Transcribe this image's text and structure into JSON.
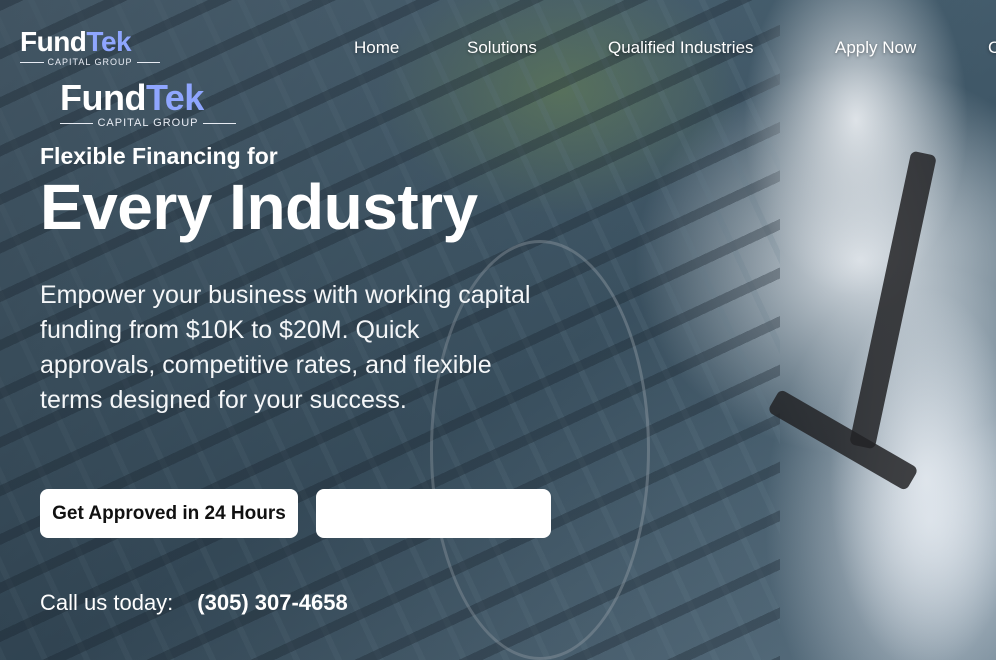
{
  "brand": {
    "name_part1": "Fund",
    "name_part2": "Tek",
    "tagline": "CAPITAL GROUP"
  },
  "nav": {
    "items": [
      {
        "label": "Home"
      },
      {
        "label": "Solutions"
      },
      {
        "label": "Qualified Industries"
      },
      {
        "label": "Apply Now"
      },
      {
        "label": "C"
      }
    ]
  },
  "hero": {
    "eyebrow": "Flexible Financing for",
    "headline": "Every Industry",
    "subcopy": "Empower your business with working capital funding from $10K to $20M. Quick approvals, competitive rates, and flexible terms designed for your success.",
    "primary_cta": "Get Approved in 24 Hours",
    "secondary_cta": "",
    "call_label": "Call us today:",
    "phone": "(305) 307-4658"
  },
  "colors": {
    "brand_accent": "#8fa6ff",
    "text": "#ffffff",
    "button_bg": "#ffffff",
    "button_text": "#111111"
  }
}
